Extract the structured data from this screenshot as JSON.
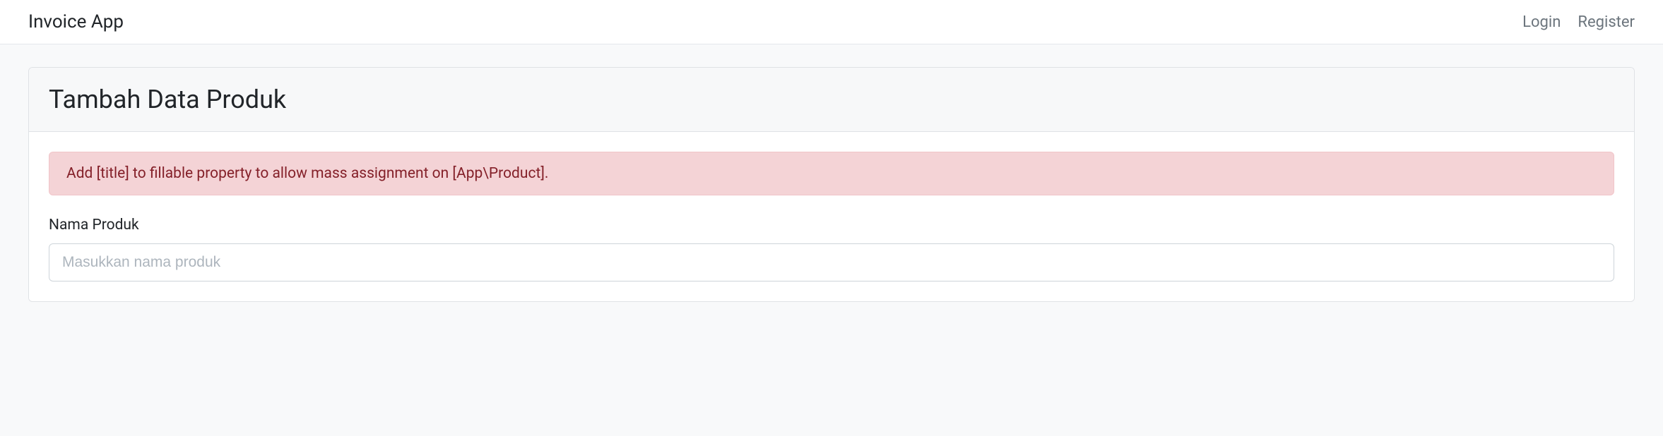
{
  "navbar": {
    "brand": "Invoice App",
    "links": {
      "login": "Login",
      "register": "Register"
    }
  },
  "card": {
    "title": "Tambah Data Produk",
    "alert": "Add [title] to fillable property to allow mass assignment on [App\\Product].",
    "form": {
      "product_name_label": "Nama Produk",
      "product_name_placeholder": "Masukkan nama produk",
      "product_name_value": ""
    }
  }
}
